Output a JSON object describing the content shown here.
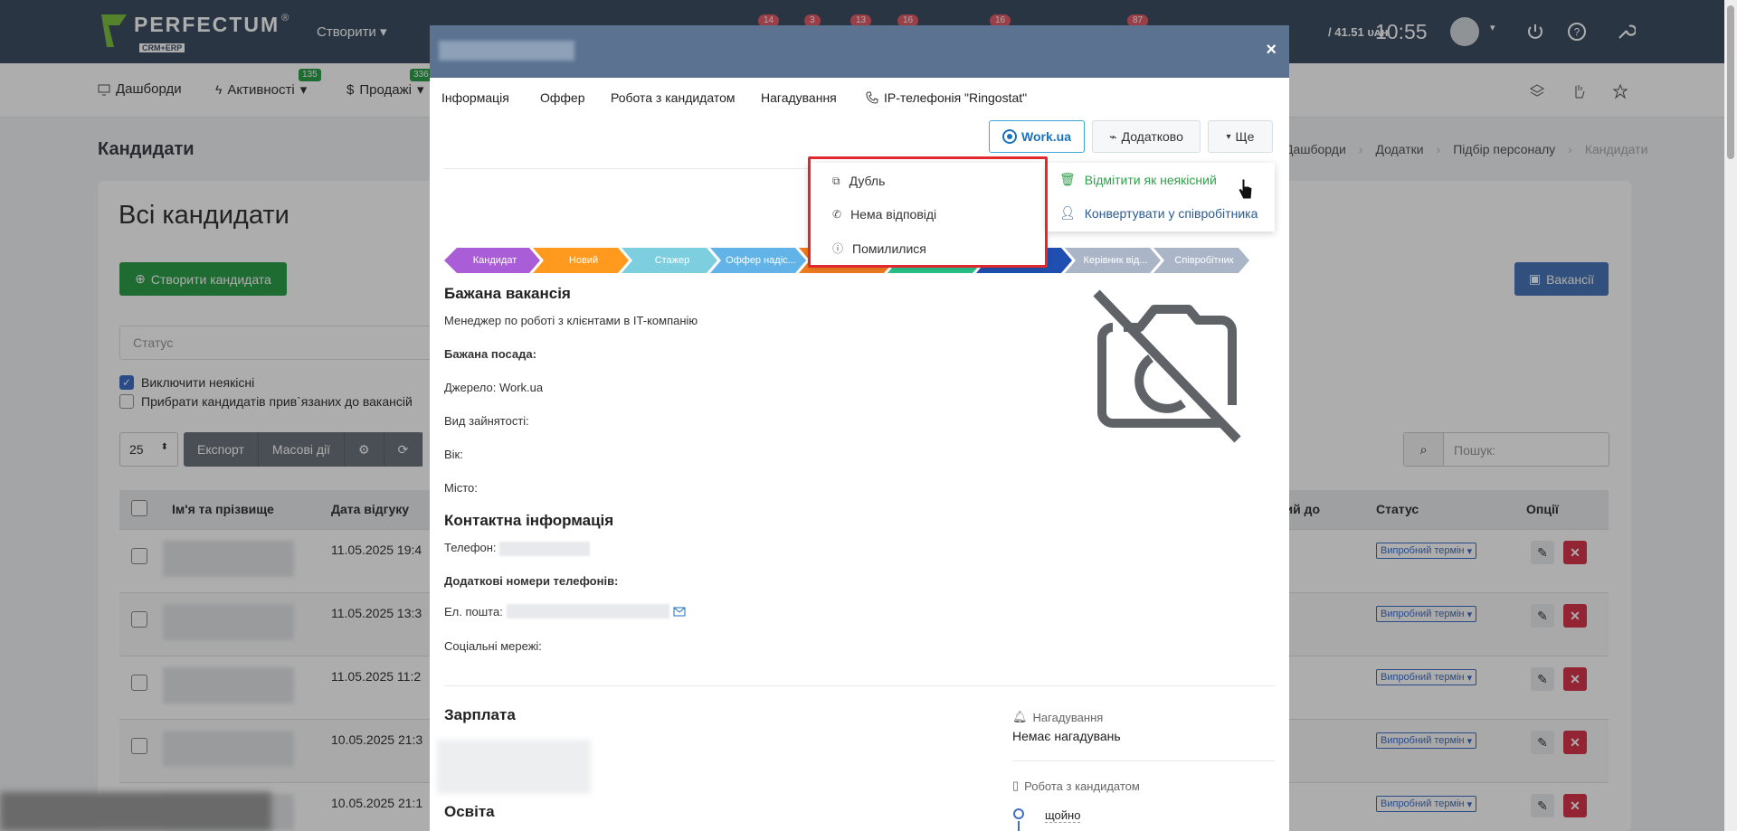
{
  "topbar": {
    "logo_text": "PERFECTUM",
    "logo_sub": "CRM+ERP",
    "logo_reg": "®",
    "create_label": "Створити",
    "badges": [
      "14",
      "3",
      "13",
      "16",
      "16",
      "87"
    ],
    "balance": "/ 41.51 ᴜᴀʜ",
    "time": "10:55"
  },
  "nav": {
    "items": [
      {
        "label": "Дашборди"
      },
      {
        "label": "Активності",
        "badge": "135"
      },
      {
        "label": "Продажі",
        "badge": "336"
      }
    ]
  },
  "page": {
    "title": "Кандидати",
    "breadcrumbs": [
      "Дашборди",
      "Додатки",
      "Підбір персоналу",
      "Кандидати"
    ],
    "panel_title": "Всі кандидати",
    "create_button": "Створити кандидата",
    "vacancies_button": "Вакансії",
    "status_placeholder": "Статус",
    "check_inactive": "Виключити неякісні",
    "check_linked": "Прибрати кандидатів прив`язаних до вакансій",
    "per_page": "25",
    "export": "Експорт",
    "bulk_actions": "Масові дії",
    "search_placeholder": "Пошук:"
  },
  "table": {
    "headers": [
      "Ім'я та прізвище",
      "Дата відгуку",
      "ний до",
      "Статус",
      "Опції"
    ],
    "rows": [
      {
        "date": "11.05.2025 19:4",
        "status": "Випробний термін"
      },
      {
        "date": "11.05.2025 13:3",
        "status": "Випробний термін"
      },
      {
        "date": "11.05.2025 11:2",
        "status": "Випробний термін"
      },
      {
        "date": "10.05.2025 21:3",
        "status": "Випробний термін"
      },
      {
        "date": "10.05.2025 21:1",
        "status": "Випробний термін"
      }
    ]
  },
  "modal": {
    "tabs": [
      "Інформація",
      "Оффер",
      "Робота з кандидатом",
      "Нагадування",
      "IP-телефонія \"Ringostat\""
    ],
    "btn_workua": "Work.ua",
    "btn_extra": "Додатково",
    "btn_more": "Ще",
    "pipeline": [
      {
        "label": "Кандидат",
        "color": "#a95ed8"
      },
      {
        "label": "Новий",
        "color": "#ff9a1f"
      },
      {
        "label": "Стажер",
        "color": "#7dcfe0"
      },
      {
        "label": "Оффер надіс...",
        "color": "#62b3e8"
      },
      {
        "label": "",
        "color": "#f07b1f"
      },
      {
        "label": "",
        "color": "#29c48a"
      },
      {
        "label": "ий т...",
        "color": "#1f4fb0"
      },
      {
        "label": "Керівник від...",
        "color": "#aab6c8"
      },
      {
        "label": "Співробітник",
        "color": "#aab6c8"
      }
    ],
    "vacancy_title": "Бажана вакансія",
    "vacancy_value": "Менеджер по роботі з клієнтами в IT-компанію",
    "desired_position": "Бажана посада:",
    "source": "Джерело: Work.ua",
    "employment": "Вид зайнятості:",
    "age": "Вік:",
    "city": "Місто:",
    "contact_title": "Контактна інформація",
    "phone": "Телефон:",
    "extra_phones": "Додаткові номери телефонів:",
    "email": "Ел. пошта:",
    "social": "Соціальні мережі:",
    "salary_title": "Зарплата",
    "education_title": "Освіта",
    "reminders_label": "Нагадування",
    "reminders_value": "Немає нагадувань",
    "work_label": "Робота з кандидатом",
    "work_item": "щойно"
  },
  "dropdown": {
    "left": [
      "Дубль",
      "Нема відповіді",
      "Помилилися"
    ],
    "right_mark_inactive": "Відмітити як неякісний",
    "right_convert": "Конвертувати у співробітника"
  },
  "colors": {
    "topbar": "#3e4f63",
    "green": "#2fa04b",
    "blue": "#4a76b8",
    "red": "#d9354d",
    "highlight": "#e0282d"
  }
}
